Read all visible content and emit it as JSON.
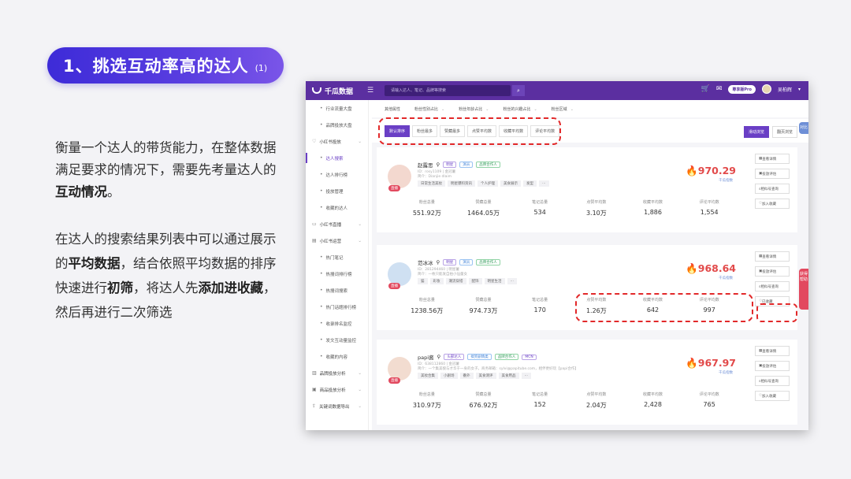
{
  "slide": {
    "title": "1、挑选互动率高的达人",
    "title_suffix": "(1)",
    "p1": {
      "a": "衡量一个达人的带货能力，在整体数据满足要求的情况下，需要先考量达人的",
      "b": "互动情况",
      "c": "。"
    },
    "p2": {
      "a": "在达人的搜索结果列表中可以通过展示的",
      "b": "平均数据",
      "c": "，结合依照平均数据的排序快速进行",
      "d": "初筛",
      "e": "，将达人先",
      "f": "添加进收藏",
      "g": "，然后再进行二次筛选"
    }
  },
  "app": {
    "logo": "千瓜数据",
    "search_placeholder": "请输入达人、笔记、品牌等搜索",
    "vip": "尊享版Pro",
    "user": "吴柏辉"
  },
  "sidebar": {
    "items": [
      {
        "label": "行业流量大盘",
        "type": "sub"
      },
      {
        "label": "品牌投放大盘",
        "type": "sub"
      },
      {
        "label": "小红书投放",
        "type": "section",
        "icon": "heart-icon"
      },
      {
        "label": "达人搜索",
        "type": "sub",
        "active": true
      },
      {
        "label": "达人排行榜",
        "type": "sub"
      },
      {
        "label": "投放管理",
        "type": "sub"
      },
      {
        "label": "收藏的达人",
        "type": "sub"
      },
      {
        "label": "小红书直播",
        "type": "section",
        "icon": "tv-icon"
      },
      {
        "label": "小红书运营",
        "type": "section",
        "icon": "book-icon"
      },
      {
        "label": "热门笔记",
        "type": "sub"
      },
      {
        "label": "热搜词排行榜",
        "type": "sub"
      },
      {
        "label": "热搜词搜索",
        "type": "sub"
      },
      {
        "label": "热门话题排行榜",
        "type": "sub"
      },
      {
        "label": "收录排名监控",
        "type": "sub"
      },
      {
        "label": "发文互动量监控",
        "type": "sub"
      },
      {
        "label": "收藏的内容",
        "type": "sub"
      },
      {
        "label": "品牌投放分析",
        "type": "section",
        "icon": "chart-icon"
      },
      {
        "label": "商品投放分析",
        "type": "section",
        "icon": "cart-icon"
      },
      {
        "label": "关键词数据导出",
        "type": "section",
        "icon": "export-icon"
      }
    ]
  },
  "filters": [
    "其他属性",
    "粉丝性别占比",
    "粉丝年龄占比",
    "粉丝的兴趣占比",
    "粉丝区域"
  ],
  "sort": {
    "buttons": [
      "默认排序",
      "粉丝最多",
      "赞藏最多",
      "点赞平均数",
      "收藏平均数",
      "评论平均数"
    ],
    "active_index": 0,
    "right": [
      "滑动浏览",
      "翻页浏览"
    ]
  },
  "stat_labels": [
    "粉丝总量",
    "赞藏总量",
    "笔记总量",
    "点赞平均数",
    "收藏平均数",
    "评论平均数"
  ],
  "actions": [
    "查看详情",
    "投放评估",
    "相似号查询",
    "加入收藏"
  ],
  "score_label": "千瓜指数",
  "live_label": "直播",
  "cards": [
    {
      "name": "赵露思",
      "tags": [
        "明星",
        "演员",
        "品牌合作人"
      ],
      "meta1": "ID：rosy1109 | 金冠薯",
      "meta2": "简介：Dianjie dlaim",
      "chips": [
        "日常生活美妆",
        "明星爆料资讯",
        "个人护理",
        "美食展示",
        "发型"
      ],
      "score": "970.29",
      "stats": [
        "551.92万",
        "1464.05万",
        "534",
        "3.10万",
        "1,886",
        "1,554"
      ],
      "collect_label": "加入收藏"
    },
    {
      "name": "范冰冰",
      "tags": [
        "明星",
        "演员",
        "品牌合作人"
      ],
      "meta1": "ID：281294460 | 明星薯",
      "meta2": "简介：一枚只能发自拍小仙童女",
      "chips": [
        "猫",
        "彩妆",
        "潮流穿搭",
        "配饰",
        "明星生活"
      ],
      "score": "968.64",
      "stats": [
        "1238.56万",
        "974.73万",
        "170",
        "1.26万",
        "642",
        "997"
      ],
      "collect_label": "已收藏"
    },
    {
      "name": "papi酱",
      "tags": [
        "头部达人",
        "搞笑剧情类",
        "品牌合作人",
        "MCN"
      ],
      "meta1": "ID：638112860 | 金冠薯",
      "meta2": "简介：一个集美貌与才华于一身的女子。商务邮箱：sylvi@papitube.com，相伴更好玩【papi合作】",
      "chips": [
        "美妆合集",
        "小剧场",
        "番外",
        "美食测评",
        "美食用品"
      ],
      "score": "967.97",
      "stats": [
        "310.97万",
        "676.92万",
        "152",
        "2.04万",
        "2,428",
        "765"
      ],
      "collect_label": "加入收藏"
    }
  ],
  "side_tabs": [
    "对比",
    "获得帮助"
  ],
  "colors": {
    "accent": "#6a3fc5",
    "topbar": "#5b2fa0",
    "highlight": "#e2292a",
    "score": "#e24a4a"
  }
}
